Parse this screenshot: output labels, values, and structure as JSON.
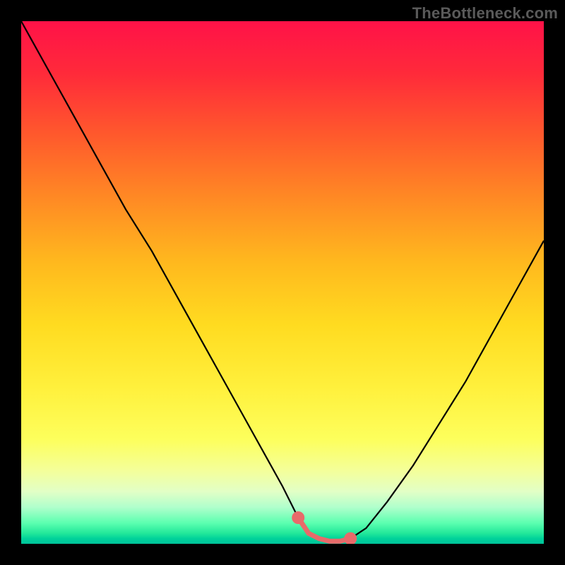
{
  "watermark": "TheBottleneck.com",
  "colors": {
    "gradient_top": "#ff1248",
    "gradient_mid": "#ffdb20",
    "gradient_bottom": "#00c29a",
    "frame": "#000000",
    "curve": "#000000",
    "marker": "#e86a6a"
  },
  "chart_data": {
    "type": "line",
    "title": "",
    "xlabel": "",
    "ylabel": "",
    "xlim": [
      0,
      100
    ],
    "ylim": [
      0,
      100
    ],
    "grid": false,
    "legend": false,
    "series": [
      {
        "name": "bottleneck-curve",
        "x": [
          0,
          5,
          10,
          15,
          20,
          25,
          30,
          35,
          40,
          45,
          50,
          53,
          55,
          57,
          59,
          61,
          63,
          66,
          70,
          75,
          80,
          85,
          90,
          95,
          100
        ],
        "y": [
          100,
          91,
          82,
          73,
          64,
          56,
          47,
          38,
          29,
          20,
          11,
          5,
          2,
          1,
          0.5,
          0.5,
          1,
          3,
          8,
          15,
          23,
          31,
          40,
          49,
          58
        ]
      }
    ],
    "markers": {
      "name": "highlight-segment",
      "x": [
        53,
        55,
        57,
        59,
        61,
        63
      ],
      "y": [
        5,
        2,
        1,
        0.5,
        0.5,
        1
      ]
    }
  }
}
